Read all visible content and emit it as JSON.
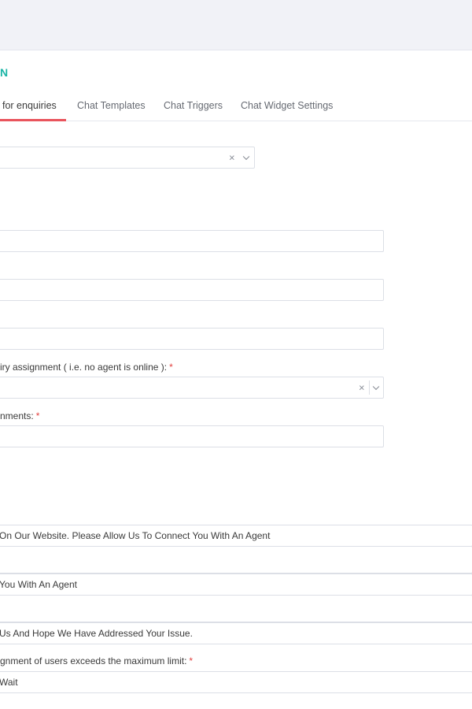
{
  "header": {
    "title_fragment": "N"
  },
  "tabs": [
    {
      "label": "for enquiries",
      "active": true
    },
    {
      "label": "Chat Templates",
      "active": false
    },
    {
      "label": "Chat Triggers",
      "active": false
    },
    {
      "label": "Chat Widget Settings",
      "active": false
    }
  ],
  "form": {
    "select_top": {
      "value": "",
      "clear": "×"
    },
    "input_1": {
      "value": ""
    },
    "input_2": {
      "value": ""
    },
    "input_3": {
      "value": ""
    },
    "label_unassigned": {
      "text": "iry assignment ( i.e. no agent is online ):",
      "required": "*"
    },
    "select_unassigned": {
      "value": "",
      "clear": "×"
    },
    "label_comments": {
      "text": "nments:",
      "required": "*"
    },
    "input_comments": {
      "value": ""
    },
    "message_welcome": {
      "value": "On Our Website. Please Allow Us To Connect You With An Agent"
    },
    "message_empty_1": {
      "value": ""
    },
    "message_connect": {
      "value": "You With An Agent"
    },
    "message_empty_2": {
      "value": ""
    },
    "message_thanks": {
      "value": "Us And Hope We Have Addressed Your Issue."
    },
    "label_limit": {
      "text": "gnment of users exceeds the maximum limit:",
      "required": "*"
    },
    "message_wait": {
      "value": "Wait"
    }
  }
}
